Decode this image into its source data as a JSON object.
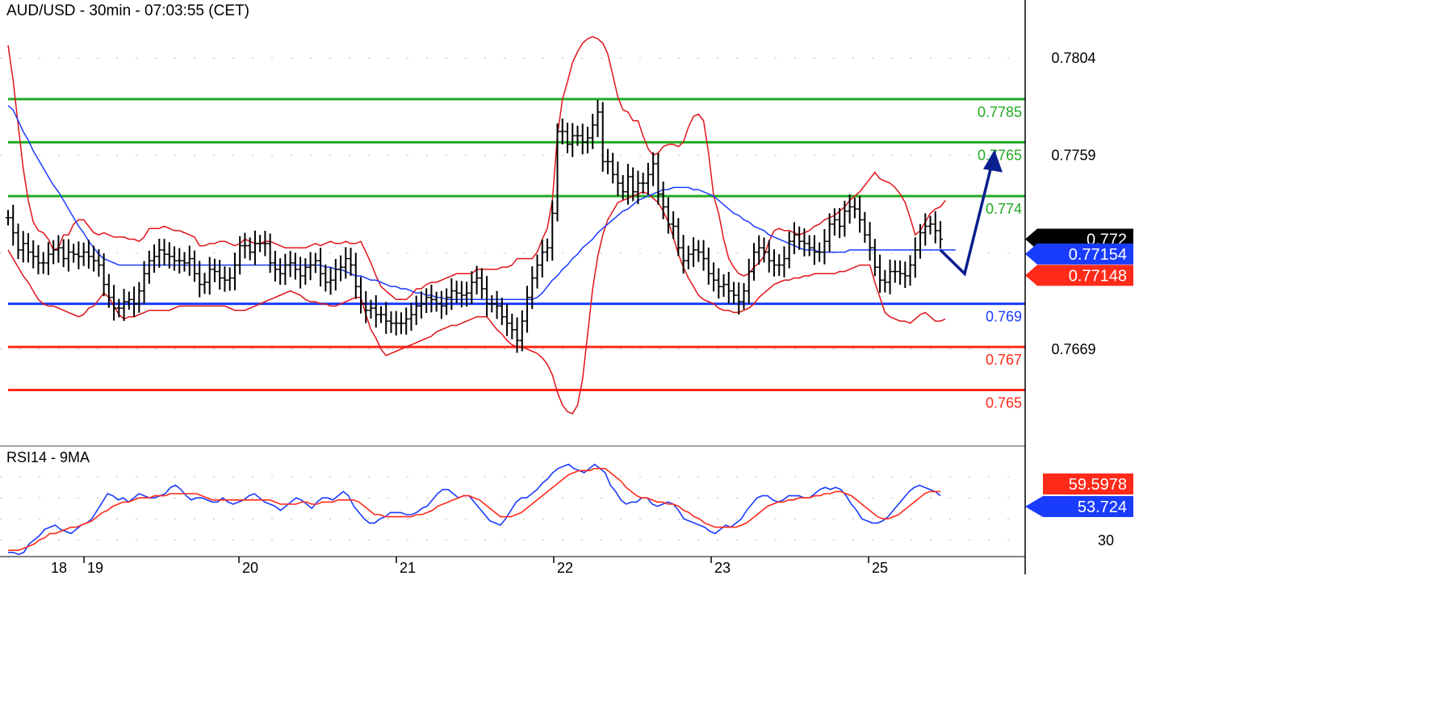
{
  "title": "AUD/USD - 30min - 07:03:55 (CET)",
  "chart_data": [
    {
      "type": "candlestick",
      "title": "AUD/USD - 30min - 07:03:55 (CET)",
      "ylim": [
        0.7624,
        0.7831
      ],
      "price_ticks": [
        "0.7804",
        "0.7759",
        "0.7669"
      ],
      "levels": [
        {
          "label": "0.7785",
          "value": 0.7785,
          "color": "#22aa22"
        },
        {
          "label": "0.7765",
          "value": 0.7765,
          "color": "#22aa22"
        },
        {
          "label": "0.774",
          "value": 0.774,
          "color": "#22aa22"
        },
        {
          "label": "0.769",
          "value": 0.769,
          "color": "#1a3cff"
        },
        {
          "label": "0.767",
          "value": 0.767,
          "color": "#ff2a1a"
        },
        {
          "label": "0.765",
          "value": 0.765,
          "color": "#ff2a1a"
        }
      ],
      "markers": [
        {
          "label": "0.772",
          "value": 0.772,
          "color": "#000000"
        },
        {
          "label": "0.77154",
          "value": 0.77154,
          "color": "#1a3cff"
        },
        {
          "label": "0.77148",
          "value": 0.77148,
          "color": "#ff2a1a"
        }
      ],
      "x_labels": [
        "18",
        "19",
        "20",
        "21",
        "22",
        "23",
        "25"
      ],
      "close": [
        0.773,
        0.7723,
        0.7715,
        0.7718,
        0.7714,
        0.7712,
        0.7709,
        0.7709,
        0.7713,
        0.7715,
        0.7716,
        0.7711,
        0.7714,
        0.7713,
        0.7712,
        0.7714,
        0.7712,
        0.771,
        0.7708,
        0.7699,
        0.7693,
        0.7688,
        0.7688,
        0.7691,
        0.7692,
        0.769,
        0.7696,
        0.7704,
        0.771,
        0.7712,
        0.7715,
        0.7713,
        0.7712,
        0.771,
        0.771,
        0.7709,
        0.7711,
        0.7704,
        0.7699,
        0.77,
        0.7706,
        0.7705,
        0.7702,
        0.7701,
        0.7702,
        0.7708,
        0.7717,
        0.7717,
        0.7714,
        0.7718,
        0.7718,
        0.7718,
        0.7709,
        0.7706,
        0.7704,
        0.7708,
        0.7709,
        0.7706,
        0.7703,
        0.7707,
        0.7708,
        0.771,
        0.7704,
        0.77,
        0.7701,
        0.7706,
        0.7707,
        0.7711,
        0.7708,
        0.7698,
        0.769,
        0.7687,
        0.7688,
        0.7685,
        0.7685,
        0.7682,
        0.7681,
        0.7681,
        0.7681,
        0.7683,
        0.7685,
        0.7689,
        0.769,
        0.7693,
        0.7692,
        0.769,
        0.7689,
        0.7693,
        0.7696,
        0.7695,
        0.7694,
        0.7695,
        0.77,
        0.7702,
        0.7697,
        0.769,
        0.769,
        0.7689,
        0.7684,
        0.7681,
        0.7678,
        0.7673,
        0.7682,
        0.7693,
        0.7702,
        0.7708,
        0.7714,
        0.7716,
        0.7732,
        0.777,
        0.777,
        0.7764,
        0.7768,
        0.7768,
        0.7765,
        0.7767,
        0.7773,
        0.7779,
        0.7756,
        0.7756,
        0.775,
        0.7746,
        0.7742,
        0.7749,
        0.7742,
        0.7746,
        0.7746,
        0.775,
        0.7755,
        0.7741,
        0.7735,
        0.7727,
        0.7726,
        0.7716,
        0.771,
        0.7713,
        0.7715,
        0.7714,
        0.7711,
        0.7704,
        0.7701,
        0.7698,
        0.7699,
        0.7696,
        0.7694,
        0.7691,
        0.7696,
        0.7705,
        0.7714,
        0.7716,
        0.7714,
        0.771,
        0.7708,
        0.7708,
        0.7711,
        0.7719,
        0.7722,
        0.7719,
        0.7718,
        0.7716,
        0.7714,
        0.7714,
        0.7719,
        0.7727,
        0.7729,
        0.7726,
        0.7733,
        0.7735,
        0.7734,
        0.7729,
        0.7722,
        0.7716,
        0.7707,
        0.7701,
        0.77,
        0.7705,
        0.7705,
        0.7704,
        0.7703,
        0.7708,
        0.7715,
        0.7723,
        0.7726,
        0.7727,
        0.7724,
        0.772
      ],
      "upper_band": [
        0.781,
        0.7794,
        0.7773,
        0.7753,
        0.7738,
        0.7728,
        0.7724,
        0.7723,
        0.772,
        0.7715,
        0.7716,
        0.7722,
        0.7722,
        0.7727,
        0.7729,
        0.7729,
        0.7726,
        0.7723,
        0.7722,
        0.7723,
        0.7722,
        0.7721,
        0.7721,
        0.7721,
        0.772,
        0.772,
        0.7719,
        0.7721,
        0.7725,
        0.7725,
        0.7725,
        0.7726,
        0.7725,
        0.7724,
        0.7724,
        0.7723,
        0.7722,
        0.7721,
        0.7717,
        0.7717,
        0.7718,
        0.7718,
        0.7719,
        0.7719,
        0.7718,
        0.7717,
        0.7718,
        0.772,
        0.7719,
        0.7718,
        0.7718,
        0.7719,
        0.7719,
        0.7718,
        0.7717,
        0.7716,
        0.7716,
        0.7716,
        0.7716,
        0.7716,
        0.7717,
        0.7718,
        0.7717,
        0.7718,
        0.7719,
        0.7718,
        0.7718,
        0.7719,
        0.7718,
        0.7718,
        0.7719,
        0.7714,
        0.7709,
        0.7703,
        0.7698,
        0.7696,
        0.7694,
        0.7692,
        0.7692,
        0.7692,
        0.7694,
        0.7697,
        0.7697,
        0.7699,
        0.77,
        0.77,
        0.7701,
        0.7702,
        0.7703,
        0.7704,
        0.7704,
        0.7704,
        0.7704,
        0.7706,
        0.7706,
        0.7706,
        0.7706,
        0.7706,
        0.7707,
        0.7707,
        0.7708,
        0.7711,
        0.7711,
        0.7711,
        0.7711,
        0.7714,
        0.772,
        0.7725,
        0.7738,
        0.7768,
        0.7785,
        0.7793,
        0.7802,
        0.7807,
        0.7811,
        0.7813,
        0.7814,
        0.7813,
        0.7811,
        0.7806,
        0.7796,
        0.7786,
        0.778,
        0.7779,
        0.7775,
        0.7775,
        0.7768,
        0.7762,
        0.7759,
        0.776,
        0.7763,
        0.7764,
        0.7764,
        0.7763,
        0.7765,
        0.7772,
        0.7777,
        0.7778,
        0.7775,
        0.776,
        0.774,
        0.7732,
        0.772,
        0.7711,
        0.7707,
        0.7704,
        0.7703,
        0.7704,
        0.7707,
        0.7709,
        0.7712,
        0.7719,
        0.7724,
        0.7725,
        0.7724,
        0.7724,
        0.7723,
        0.7722,
        0.7723,
        0.7724,
        0.7726,
        0.7727,
        0.7729,
        0.773,
        0.7731,
        0.7733,
        0.7735,
        0.7738,
        0.774,
        0.7742,
        0.7745,
        0.7748,
        0.7751,
        0.7748,
        0.7747,
        0.7746,
        0.7744,
        0.7741,
        0.7737,
        0.773,
        0.7722,
        0.7724,
        0.7728,
        0.7732,
        0.7734,
        0.7735,
        0.7738
      ],
      "lower_band": [
        0.7715,
        0.7711,
        0.7707,
        0.7703,
        0.77,
        0.7696,
        0.7692,
        0.769,
        0.7689,
        0.7689,
        0.7688,
        0.7687,
        0.7686,
        0.7685,
        0.7684,
        0.7685,
        0.7688,
        0.7689,
        0.7692,
        0.7695,
        0.7693,
        0.7689,
        0.7685,
        0.7683,
        0.7684,
        0.7684,
        0.7685,
        0.7686,
        0.7687,
        0.7687,
        0.7687,
        0.7687,
        0.7687,
        0.7688,
        0.7689,
        0.7689,
        0.7689,
        0.7689,
        0.7689,
        0.7689,
        0.7689,
        0.7689,
        0.7689,
        0.7689,
        0.7688,
        0.7687,
        0.7687,
        0.7687,
        0.7688,
        0.7689,
        0.769,
        0.7691,
        0.7692,
        0.7693,
        0.7694,
        0.7695,
        0.7696,
        0.7695,
        0.7694,
        0.7692,
        0.7691,
        0.7691,
        0.769,
        0.769,
        0.7689,
        0.7689,
        0.769,
        0.7691,
        0.7692,
        0.7693,
        0.7693,
        0.7685,
        0.7678,
        0.7674,
        0.7669,
        0.7666,
        0.7667,
        0.7668,
        0.7669,
        0.767,
        0.7671,
        0.7672,
        0.7673,
        0.7674,
        0.7675,
        0.7677,
        0.7678,
        0.7679,
        0.768,
        0.768,
        0.7681,
        0.7682,
        0.7683,
        0.7684,
        0.7684,
        0.7684,
        0.7681,
        0.7678,
        0.7676,
        0.7673,
        0.7671,
        0.767,
        0.767,
        0.7669,
        0.7668,
        0.7667,
        0.7665,
        0.7662,
        0.7657,
        0.7649,
        0.7643,
        0.764,
        0.7639,
        0.7643,
        0.7655,
        0.7676,
        0.7697,
        0.7712,
        0.7722,
        0.7729,
        0.7733,
        0.7737,
        0.7738,
        0.7739,
        0.774,
        0.7741,
        0.7742,
        0.7741,
        0.7739,
        0.7737,
        0.7733,
        0.7728,
        0.7721,
        0.7713,
        0.7707,
        0.7702,
        0.7698,
        0.7694,
        0.7692,
        0.7691,
        0.769,
        0.7688,
        0.7687,
        0.7687,
        0.7686,
        0.7686,
        0.7687,
        0.7688,
        0.769,
        0.7693,
        0.7695,
        0.7697,
        0.7699,
        0.77,
        0.7701,
        0.7701,
        0.7702,
        0.7702,
        0.7703,
        0.7703,
        0.7704,
        0.7704,
        0.7704,
        0.7704,
        0.7704,
        0.7705,
        0.7705,
        0.7706,
        0.7707,
        0.7708,
        0.7708,
        0.7708,
        0.77,
        0.7693,
        0.7686,
        0.7684,
        0.7683,
        0.7682,
        0.7682,
        0.7681,
        0.7683,
        0.7685,
        0.7686,
        0.7684,
        0.7682,
        0.7682,
        0.7683
      ],
      "ma_line": [
        0.7782,
        0.778,
        0.7775,
        0.777,
        0.7766,
        0.7761,
        0.7757,
        0.7753,
        0.7749,
        0.7745,
        0.7742,
        0.7738,
        0.7734,
        0.773,
        0.7726,
        0.7723,
        0.7719,
        0.7716,
        0.7713,
        0.7711,
        0.771,
        0.7709,
        0.7708,
        0.7708,
        0.7708,
        0.7708,
        0.7708,
        0.7708,
        0.7708,
        0.7708,
        0.7708,
        0.7708,
        0.7708,
        0.7708,
        0.7708,
        0.7708,
        0.7708,
        0.7708,
        0.7708,
        0.7708,
        0.7708,
        0.7708,
        0.7708,
        0.7708,
        0.7708,
        0.7708,
        0.7708,
        0.7708,
        0.7708,
        0.7708,
        0.7708,
        0.7708,
        0.7708,
        0.7708,
        0.7708,
        0.7708,
        0.7708,
        0.7708,
        0.7708,
        0.7708,
        0.7708,
        0.7708,
        0.7708,
        0.7707,
        0.7707,
        0.7706,
        0.7706,
        0.7705,
        0.7704,
        0.7703,
        0.7703,
        0.7702,
        0.7701,
        0.7701,
        0.77,
        0.7699,
        0.7698,
        0.7698,
        0.7697,
        0.7697,
        0.7696,
        0.7695,
        0.7695,
        0.7694,
        0.7694,
        0.7693,
        0.7693,
        0.7692,
        0.7692,
        0.7692,
        0.7692,
        0.7692,
        0.7692,
        0.7692,
        0.7692,
        0.7692,
        0.7692,
        0.7692,
        0.7692,
        0.7692,
        0.7692,
        0.7692,
        0.7692,
        0.7692,
        0.7692,
        0.7693,
        0.7695,
        0.7698,
        0.7701,
        0.7703,
        0.7706,
        0.7708,
        0.7711,
        0.7713,
        0.7716,
        0.7718,
        0.772,
        0.7723,
        0.7725,
        0.7727,
        0.7729,
        0.7731,
        0.7733,
        0.7734,
        0.7736,
        0.7738,
        0.7739,
        0.774,
        0.7741,
        0.7742,
        0.7743,
        0.7743,
        0.7744,
        0.7744,
        0.7744,
        0.7744,
        0.7743,
        0.7743,
        0.7742,
        0.7741,
        0.774,
        0.7738,
        0.7736,
        0.7734,
        0.7732,
        0.7731,
        0.7729,
        0.7728,
        0.7726,
        0.7725,
        0.7724,
        0.7722,
        0.7721,
        0.772,
        0.7719,
        0.7718,
        0.7717,
        0.7716,
        0.7715,
        0.7715,
        0.7715,
        0.7714,
        0.7714,
        0.7714,
        0.7714,
        0.7714,
        0.7714,
        0.7715,
        0.7715,
        0.7715,
        0.7715,
        0.7715,
        0.7715,
        0.7715,
        0.7715,
        0.7715,
        0.7715,
        0.7715,
        0.7715,
        0.7715,
        0.7715,
        0.7715,
        0.7715,
        0.7715,
        0.7715,
        0.7715,
        0.7715,
        0.7715,
        0.7715
      ],
      "forecast": [
        0.7715,
        0.7704,
        0.776
      ]
    },
    {
      "type": "line",
      "title": "RSI14 - 9MA",
      "ylim": [
        22,
        72
      ],
      "y_ticks": [
        "30"
      ],
      "markers": [
        {
          "label": "59.5978",
          "value": 59.5978,
          "color": "#ff2a1a"
        },
        {
          "label": "53.724",
          "value": 53.724,
          "color": "#1a3cff"
        }
      ],
      "series": [
        {
          "color": "#1a3cff",
          "values": [
            24,
            24,
            23,
            24,
            28,
            30,
            32,
            35,
            36,
            37,
            35,
            34,
            33,
            35,
            37,
            38,
            40,
            44,
            48,
            52,
            51,
            49,
            50,
            48,
            50,
            52,
            51,
            50,
            50,
            51,
            52,
            55,
            56,
            54,
            51,
            49,
            50,
            50,
            49,
            48,
            48,
            50,
            48,
            47,
            48,
            49,
            51,
            52,
            50,
            48,
            47,
            46,
            44,
            46,
            48,
            50,
            49,
            47,
            45,
            48,
            50,
            50,
            49,
            51,
            53,
            51,
            46,
            43,
            40,
            38,
            38,
            40,
            41,
            43,
            43,
            43,
            42,
            42,
            43,
            45,
            46,
            49,
            52,
            54,
            54,
            52,
            50,
            51,
            51,
            48,
            45,
            42,
            39,
            38,
            37,
            40,
            44,
            48,
            50,
            50,
            52,
            54,
            57,
            59,
            62,
            64,
            65,
            66,
            64,
            63,
            62,
            64,
            66,
            64,
            62,
            56,
            53,
            49,
            47,
            48,
            48,
            50,
            50,
            47,
            46,
            47,
            48,
            47,
            44,
            40,
            39,
            38,
            37,
            36,
            34,
            33,
            35,
            37,
            36,
            38,
            40,
            44,
            47,
            50,
            51,
            51,
            49,
            48,
            49,
            51,
            51,
            51,
            50,
            50,
            52,
            54,
            55,
            54,
            55,
            54,
            51,
            47,
            44,
            40,
            39,
            38,
            38,
            39,
            41,
            44,
            47,
            50,
            53,
            55,
            56,
            55,
            54,
            53,
            51
          ]
        },
        {
          "color": "#ff2a1a",
          "values": [
            25,
            25,
            25,
            26,
            27,
            28,
            30,
            31,
            33,
            33,
            34,
            35,
            36,
            36,
            37,
            38,
            39,
            41,
            43,
            44,
            46,
            47,
            48,
            48,
            49,
            50,
            50,
            50,
            51,
            51,
            51,
            52,
            52,
            52,
            52,
            52,
            52,
            51,
            50,
            49,
            49,
            49,
            49,
            49,
            49,
            49,
            49,
            49,
            49,
            49,
            49,
            48,
            47,
            47,
            47,
            47,
            48,
            48,
            47,
            47,
            48,
            48,
            48,
            49,
            49,
            49,
            49,
            48,
            46,
            44,
            42,
            42,
            41,
            41,
            41,
            41,
            41,
            41,
            42,
            42,
            43,
            44,
            46,
            47,
            48,
            49,
            50,
            51,
            51,
            50,
            49,
            47,
            45,
            43,
            41,
            41,
            41,
            42,
            43,
            45,
            47,
            49,
            51,
            53,
            55,
            57,
            59,
            61,
            62,
            63,
            63,
            63,
            64,
            64,
            64,
            62,
            60,
            58,
            55,
            53,
            51,
            50,
            50,
            49,
            48,
            48,
            47,
            47,
            46,
            44,
            43,
            41,
            40,
            38,
            37,
            36,
            36,
            36,
            36,
            36,
            37,
            38,
            40,
            42,
            44,
            46,
            47,
            48,
            48,
            49,
            49,
            50,
            50,
            50,
            51,
            51,
            52,
            52,
            53,
            53,
            52,
            51,
            49,
            47,
            45,
            43,
            41,
            40,
            40,
            41,
            42,
            44,
            46,
            48,
            50,
            52,
            53,
            53,
            53
          ]
        }
      ]
    }
  ]
}
